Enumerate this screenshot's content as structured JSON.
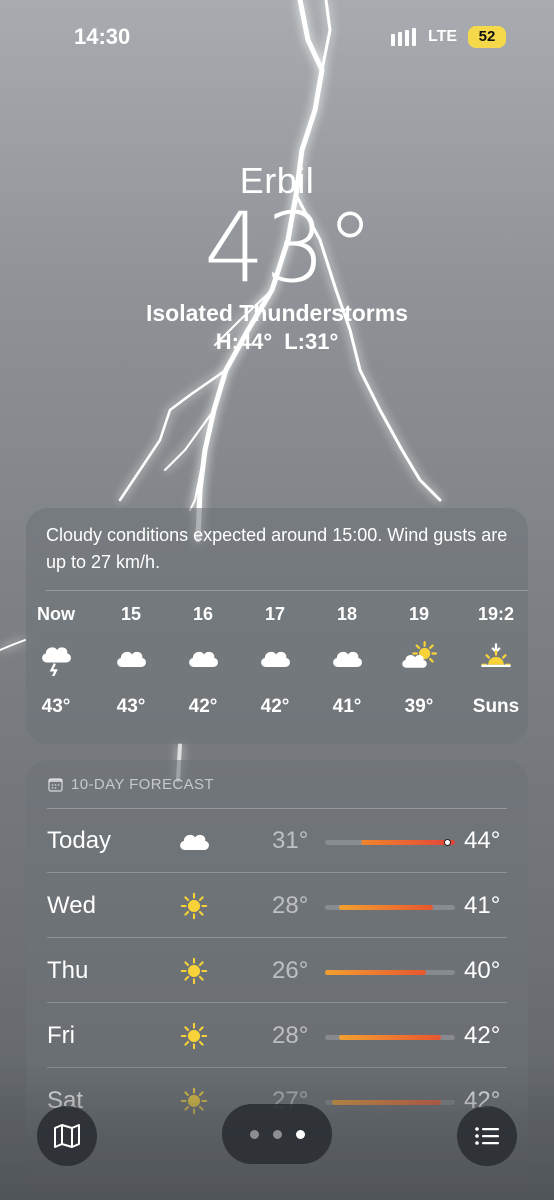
{
  "status_bar": {
    "time": "14:30",
    "network": "LTE",
    "battery": "52",
    "signal_icon": "signal-bars-icon"
  },
  "location": {
    "city": "Erbil",
    "temperature": "43°",
    "condition": "Isolated Thunderstorms",
    "high": "H:44°",
    "low": "L:31°"
  },
  "hourly": {
    "summary": "Cloudy conditions expected around 15:00. Wind gusts are up to 27 km/h.",
    "items": [
      {
        "label": "Now",
        "icon": "thunderstorm-icon",
        "temp": "43°"
      },
      {
        "label": "15",
        "icon": "cloud-icon",
        "temp": "43°"
      },
      {
        "label": "16",
        "icon": "cloud-icon",
        "temp": "42°"
      },
      {
        "label": "17",
        "icon": "cloud-icon",
        "temp": "42°"
      },
      {
        "label": "18",
        "icon": "cloud-icon",
        "temp": "41°"
      },
      {
        "label": "19",
        "icon": "partly-cloudy-icon",
        "temp": "39°"
      },
      {
        "label": "19:2",
        "icon": "sunset-icon",
        "temp": "Suns"
      }
    ]
  },
  "daily": {
    "title": "10-DAY FORECAST",
    "title_icon": "calendar-icon",
    "range_min": 26,
    "range_max": 44,
    "current_temp": 43,
    "days": [
      {
        "name": "Today",
        "icon": "cloud-icon",
        "low": "31°",
        "high": "44°",
        "low_val": 31,
        "high_val": 44
      },
      {
        "name": "Wed",
        "icon": "sun-icon",
        "low": "28°",
        "high": "41°",
        "low_val": 28,
        "high_val": 41
      },
      {
        "name": "Thu",
        "icon": "sun-icon",
        "low": "26°",
        "high": "40°",
        "low_val": 26,
        "high_val": 40
      },
      {
        "name": "Fri",
        "icon": "sun-icon",
        "low": "28°",
        "high": "42°",
        "low_val": 28,
        "high_val": 42
      },
      {
        "name": "Sat",
        "icon": "sun-icon",
        "low": "27°",
        "high": "42°",
        "low_val": 27,
        "high_val": 42
      }
    ]
  },
  "toolbar": {
    "map_icon": "map-icon",
    "list_icon": "list-icon",
    "page_count": 3,
    "active_page": 3
  },
  "colors": {
    "accent_hot": "#e2433a",
    "accent_warm": "#f0852c",
    "sun": "#f7d238",
    "battery": "#f6d94a"
  }
}
